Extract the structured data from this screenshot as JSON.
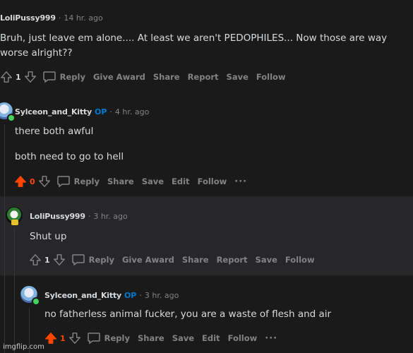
{
  "comments": [
    {
      "author": "LoliPussy999",
      "time": "14 hr. ago",
      "body": [
        "Bruh, just leave em alone.... At least we aren't PEDOPHILES... Now those are way worse alright??"
      ],
      "votes": "1",
      "actions": [
        "Reply",
        "Give Award",
        "Share",
        "Report",
        "Save",
        "Follow"
      ]
    },
    {
      "author": "Sylceon_and_Kitty",
      "op": "OP",
      "time": "4 hr. ago",
      "body": [
        "there both awful",
        "both need to go to hell"
      ],
      "votes": "0",
      "actions": [
        "Reply",
        "Share",
        "Save",
        "Edit",
        "Follow"
      ],
      "more": "···"
    },
    {
      "author": "LoliPussy999",
      "time": "3 hr. ago",
      "body": [
        "Shut up"
      ],
      "votes": "1",
      "actions": [
        "Reply",
        "Give Award",
        "Share",
        "Report",
        "Save",
        "Follow"
      ]
    },
    {
      "author": "Sylceon_and_Kitty",
      "op": "OP",
      "time": "3 hr. ago",
      "body": [
        "no fatherless animal fucker, you are a waste of flesh and air"
      ],
      "votes": "1",
      "actions": [
        "Reply",
        "Share",
        "Save",
        "Edit",
        "Follow"
      ],
      "more": "···"
    }
  ],
  "watermark": "imgflip.com",
  "colors": {
    "background": "#1a1a1b",
    "highlight": "#272729",
    "upvote": "#ff4500",
    "op": "#0079d3",
    "muted": "#818384",
    "online": "#46d160"
  },
  "icons": [
    "arrow-up-icon",
    "arrow-down-icon",
    "comment-bubble-icon",
    "more-icon",
    "avatar-icon"
  ]
}
